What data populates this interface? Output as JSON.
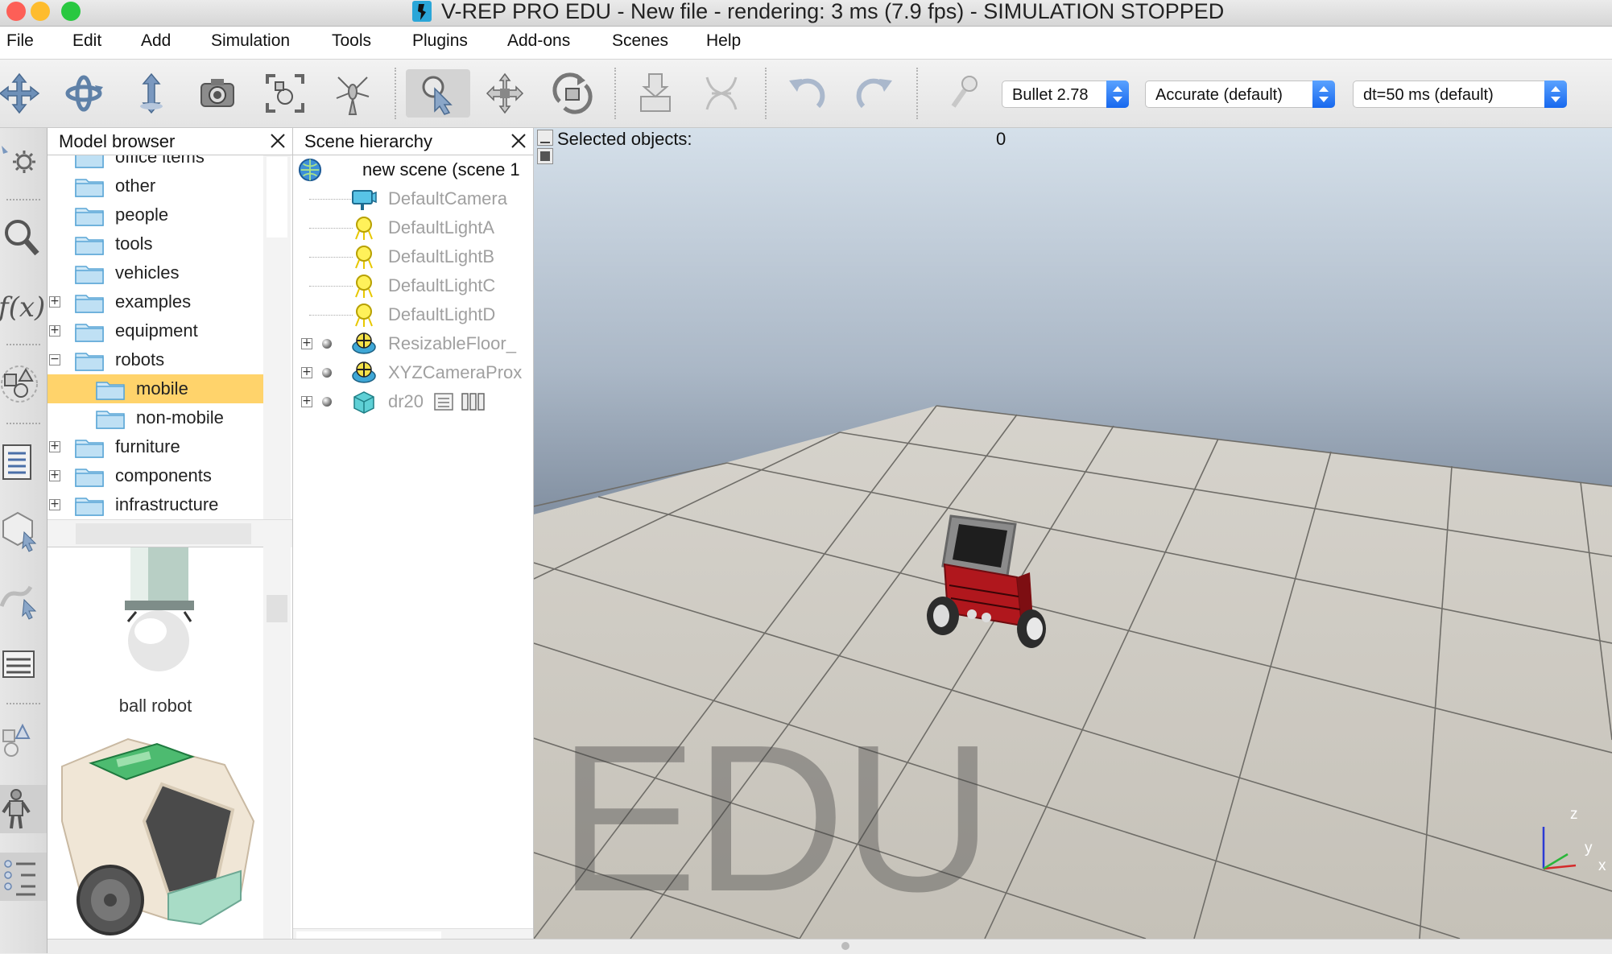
{
  "window": {
    "title": "V-REP PRO EDU - New file - rendering: 3 ms (7.9 fps) - SIMULATION STOPPED",
    "traffic_lights": [
      "#fd5f57",
      "#febc2e",
      "#29c840"
    ]
  },
  "menu": [
    "File",
    "Edit",
    "Add",
    "Simulation",
    "Tools",
    "Plugins",
    "Add-ons",
    "Scenes",
    "Help"
  ],
  "toolbar": {
    "buttons": [
      {
        "name": "camera-pan-icon"
      },
      {
        "name": "camera-rotate-icon"
      },
      {
        "name": "camera-shift-icon"
      },
      {
        "name": "camera-angle-icon"
      },
      {
        "name": "fit-to-view-icon"
      },
      {
        "name": "manipulation-icon"
      },
      {
        "name": "click-select-icon"
      },
      {
        "name": "object-shift-icon"
      },
      {
        "name": "object-rotate-icon"
      },
      {
        "name": "assemble-icon"
      },
      {
        "name": "transfer-dna-icon"
      },
      {
        "name": "undo-icon"
      },
      {
        "name": "redo-icon"
      },
      {
        "name": "simulation-settings-icon"
      }
    ],
    "physics_engine": "Bullet 2.78",
    "accuracy": "Accurate (default)",
    "timestep": "dt=50 ms (default)"
  },
  "left_toolbar": [
    "calculation-module-icon",
    "selection-icon",
    "scripts-icon",
    "shapes-icon",
    "scene-objects-icon",
    "model-icon",
    "path-icon",
    "layers-icon",
    "primitives-icon",
    "model-browser-icon",
    "scene-hierarchy-icon"
  ],
  "model_browser": {
    "title": "Model browser",
    "tree": [
      {
        "label": "office items",
        "indent": 1,
        "expander": false
      },
      {
        "label": "other",
        "indent": 1,
        "expander": false
      },
      {
        "label": "people",
        "indent": 1,
        "expander": false
      },
      {
        "label": "tools",
        "indent": 1,
        "expander": false
      },
      {
        "label": "vehicles",
        "indent": 1,
        "expander": false
      },
      {
        "label": "examples",
        "indent": 1,
        "expander": true
      },
      {
        "label": "equipment",
        "indent": 1,
        "expander": true
      },
      {
        "label": "robots",
        "indent": 1,
        "expander": "minus"
      },
      {
        "label": "mobile",
        "indent": 2,
        "expander": false,
        "selected": true
      },
      {
        "label": "non-mobile",
        "indent": 2,
        "expander": false
      },
      {
        "label": "furniture",
        "indent": 1,
        "expander": true
      },
      {
        "label": "components",
        "indent": 1,
        "expander": true
      },
      {
        "label": "infrastructure",
        "indent": 1,
        "expander": true
      }
    ],
    "thumbnails": [
      {
        "label": "ball robot"
      },
      {
        "label": ""
      }
    ]
  },
  "scene_hierarchy": {
    "title": "Scene hierarchy",
    "root": "new scene (scene 1",
    "items": [
      {
        "label": "DefaultCamera",
        "icon": "camera-icon"
      },
      {
        "label": "DefaultLightA",
        "icon": "light-icon"
      },
      {
        "label": "DefaultLightB",
        "icon": "light-icon"
      },
      {
        "label": "DefaultLightC",
        "icon": "light-icon"
      },
      {
        "label": "DefaultLightD",
        "icon": "light-icon"
      },
      {
        "label": "ResizableFloor_",
        "icon": "dummy-icon"
      },
      {
        "label": "XYZCameraProx",
        "icon": "dummy-icon"
      },
      {
        "label": "dr20",
        "icon": "shape-icon"
      }
    ]
  },
  "viewport": {
    "selected_label": "Selected objects:",
    "selected_count": "0",
    "watermark": "EDU",
    "axes": {
      "x": "x",
      "y": "y",
      "z": "z"
    }
  }
}
